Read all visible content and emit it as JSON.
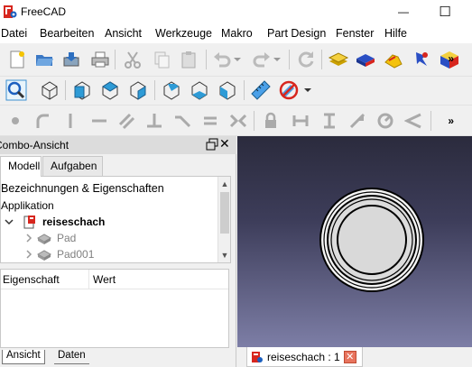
{
  "window": {
    "title": "FreeCAD",
    "minimize_glyph": "—",
    "maximize_glyph": "☐"
  },
  "menu": [
    "Datei",
    "Bearbeiten",
    "Ansicht",
    "Werkzeuge",
    "Makro",
    "Part Design",
    "Fenster",
    "Hilfe"
  ],
  "toolbar": {
    "overflow": "»"
  },
  "combo": {
    "title": "Combo-Ansicht",
    "tabs": [
      "Modell",
      "Aufgaben"
    ],
    "tree": {
      "header": "Bezeichnungen & Eigenschaften",
      "application": "Applikation",
      "document": "reiseschach",
      "items": [
        "Pad",
        "Pad001"
      ]
    },
    "properties": {
      "col1": "Eigenschaft",
      "col2": "Wert"
    },
    "bottom_tabs": [
      "Ansicht",
      "Daten"
    ]
  },
  "view": {
    "tab_label": "reiseschach : 1"
  },
  "colors": {
    "accent_red": "#d7261e",
    "view_bg_top": "#2b2b3d",
    "view_bg_bottom": "#7d7ea6",
    "model_fill": "#d9d9d9"
  }
}
